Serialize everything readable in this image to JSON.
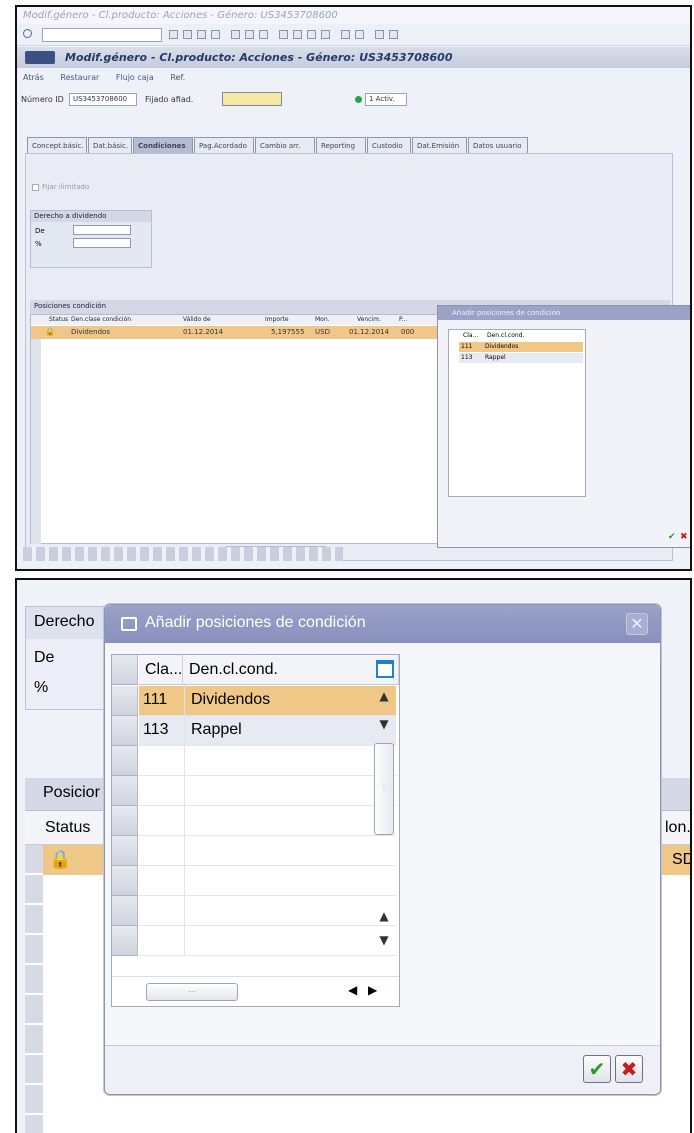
{
  "top_panel": {
    "window_title": "Modif.género - Cl.producto: Acciones - Género: US3453708600",
    "screen_title": "Modif.género - Cl.producto: Acciones - Género: US3453708600",
    "toolbar_items": [
      "Atrás",
      "Restaurar",
      "Flujo caja",
      "Ref."
    ],
    "header": {
      "number_label": "Número ID",
      "number_value": "US3453708600",
      "status_label": "Fijado afiad.",
      "status_dropdown": "1 Activ."
    },
    "tabs": [
      "Concept.básic.",
      "Dat.básic.",
      "Condiciones",
      "Pag.Acordado",
      "Cambio arr.",
      "Reporting",
      "Custodio",
      "Dat.Emisión",
      "Datos usuario"
    ],
    "active_tab": 2,
    "checkbox_label": "Fijar ilimitado",
    "dividend_box": {
      "title": "Derecho a dividendo",
      "fields": [
        "De",
        "%"
      ]
    },
    "positions": {
      "title": "Posiciones condición",
      "columns": [
        "Status",
        "Den.clase condición",
        "Válido de",
        "Importe",
        "Mon.",
        "Vencim.",
        "P..."
      ],
      "row": {
        "condition": "Dividendos",
        "valid_from": "01.12.2014",
        "amount": "5,197555",
        "currency": "USD",
        "due": "01.12.2014",
        "p": "000"
      }
    },
    "mini_dialog": {
      "title": "Añadir posiciones de condición",
      "columns": [
        "Cla...",
        "Den.cl.cond."
      ],
      "rows": [
        {
          "code": "111",
          "name": "Dividendos"
        },
        {
          "code": "113",
          "name": "Rappel"
        }
      ]
    }
  },
  "bottom_panel": {
    "background": {
      "dividend_title_partial": "Derecho",
      "field_de": "De",
      "field_pct": "%",
      "positions_title_partial": "Posicior",
      "status_header_partial": "Status",
      "currency_header_partial": "lon.",
      "currency_value_partial": "SD"
    },
    "dialog": {
      "title": "Añadir posiciones de condición",
      "columns": [
        "Cla...",
        "Den.cl.cond."
      ],
      "rows": [
        {
          "code": "111",
          "name": "Dividendos"
        },
        {
          "code": "113",
          "name": "Rappel"
        }
      ]
    }
  },
  "colors": {
    "sap_blue_title": "#8890bd",
    "highlight_row": "#efc887",
    "selected_row": "#e8eaf3",
    "ok_green": "#2e9b1f",
    "cancel_red": "#cc1a1a"
  },
  "icons": [
    "lock-icon",
    "layout-columns-icon",
    "confirm-check-icon",
    "cancel-x-icon",
    "scroll-up-icon",
    "scroll-down-icon",
    "scroll-left-icon",
    "scroll-right-icon",
    "dialog-title-icon"
  ]
}
